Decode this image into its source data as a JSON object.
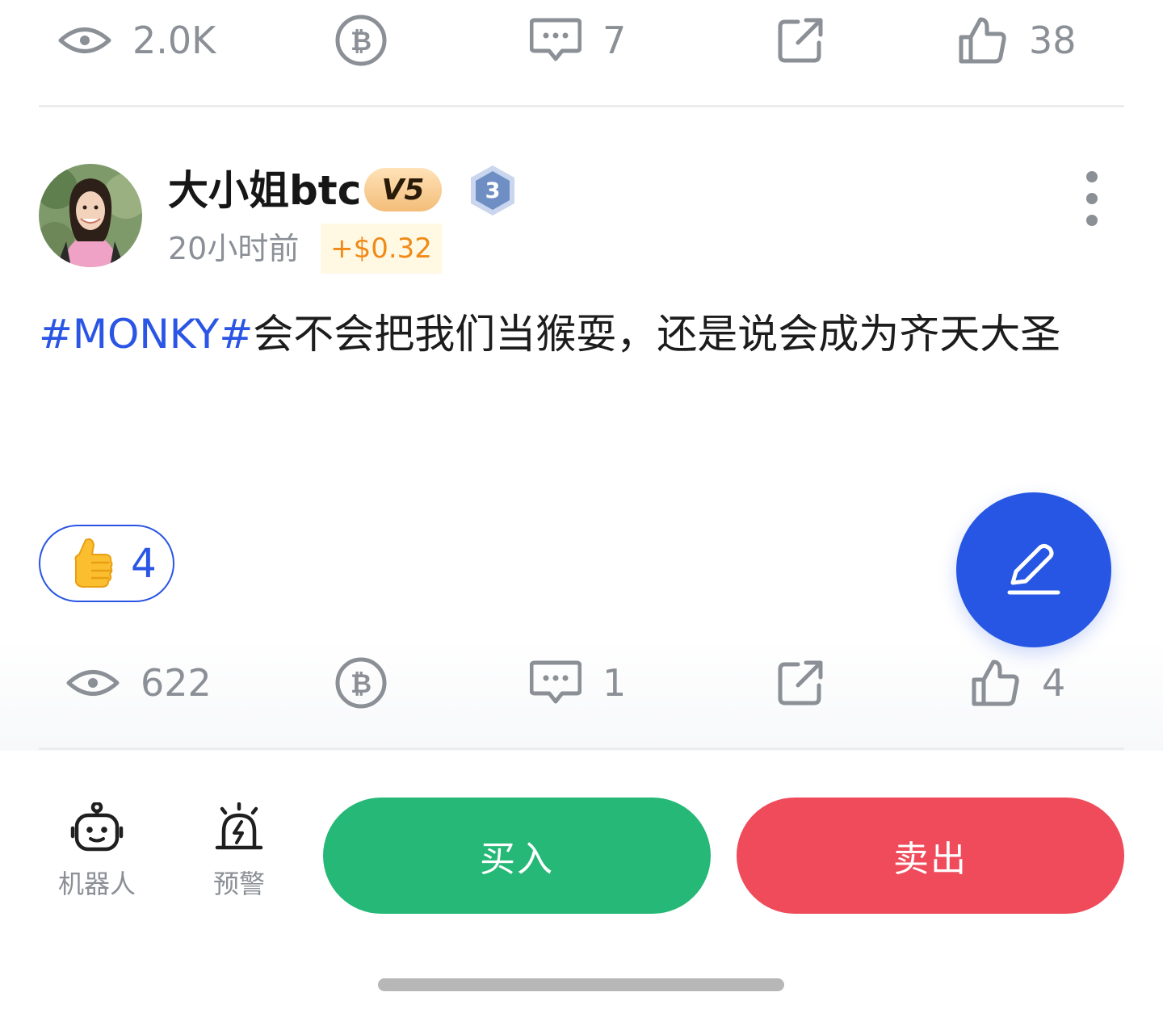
{
  "colors": {
    "accent_blue": "#2a55e5",
    "buy_green": "#25b876",
    "sell_red": "#ef4b5b",
    "muted_gray": "#8b8f96",
    "profit_orange": "#f08a17"
  },
  "previous_post": {
    "stats": {
      "views": "2.0K",
      "comments": "7",
      "likes": "38"
    }
  },
  "post": {
    "author": {
      "name": "大小姐btc",
      "vip_badge": "V5",
      "level_badge": "3",
      "avatar_icon": "avatar-photo"
    },
    "timestamp": "20小时前",
    "profit": "+$0.32",
    "content": {
      "hashtag": "#MONKY#",
      "text": "会不会把我们当猴耍，还是说会成为齐天大圣"
    },
    "reaction": {
      "emoji_icon": "thumbs-up-emoji",
      "count": "4"
    },
    "stats": {
      "views": "622",
      "comments": "1",
      "likes": "4"
    }
  },
  "fab_icon": "edit-pen-icon",
  "bottom_bar": {
    "robot_label": "机器人",
    "alert_label": "预警",
    "buy_label": "买入",
    "sell_label": "卖出"
  }
}
